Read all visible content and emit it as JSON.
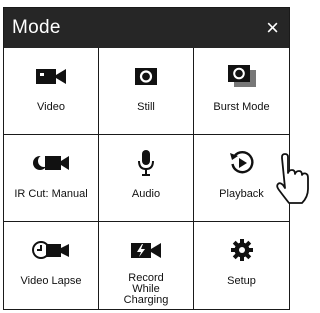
{
  "modal": {
    "title": "Mode",
    "close_glyph": "×"
  },
  "modes": [
    {
      "label": "Video",
      "icon": "video-camera-icon"
    },
    {
      "label": "Still",
      "icon": "still-photo-icon"
    },
    {
      "label": "Burst Mode",
      "icon": "burst-mode-icon"
    },
    {
      "label": "IR Cut: Manual",
      "icon": "ir-cut-icon"
    },
    {
      "label": "Audio",
      "icon": "microphone-icon"
    },
    {
      "label": "Playback",
      "icon": "playback-icon"
    },
    {
      "label": "Video Lapse",
      "icon": "video-lapse-icon"
    },
    {
      "label": "Record While Charging",
      "icon": "record-while-charging-icon"
    },
    {
      "label": "Setup",
      "icon": "gear-icon"
    }
  ],
  "colors": {
    "header_bg": "#262626",
    "icon": "#111111",
    "border": "#1a1a1a"
  }
}
